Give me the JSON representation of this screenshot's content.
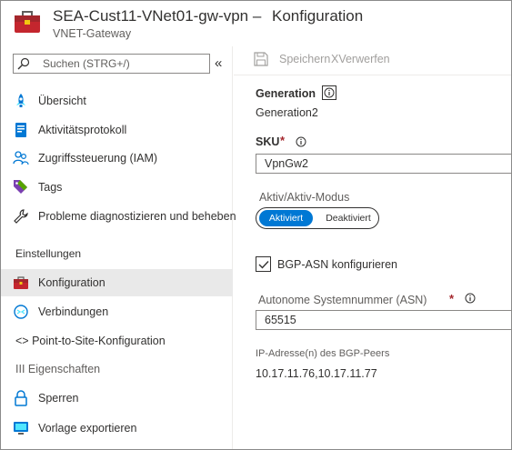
{
  "header": {
    "title": "SEA-Cust11-VNet01-gw-vpn –",
    "blade_title": "Konfiguration",
    "subtitle": "VNET-Gateway"
  },
  "sidebar": {
    "search_placeholder": "Suchen (STRG+/)",
    "collapse": "«",
    "items": [
      {
        "label": "Übersicht",
        "icon": "rocket-icon"
      },
      {
        "label": "Aktivitätsprotokoll",
        "icon": "log-icon"
      },
      {
        "label": "Zugriffssteuerung (IAM)",
        "icon": "people-icon"
      },
      {
        "label": "Tags",
        "icon": "tag-icon"
      },
      {
        "label": "Probleme diagnostizieren und beheben",
        "icon": "wrench-icon"
      }
    ],
    "section_header": "Einstellungen",
    "settings_items": [
      {
        "label": "Konfiguration",
        "icon": "toolbox-icon",
        "active": true
      },
      {
        "label": "Verbindungen",
        "icon": "connections-icon"
      },
      {
        "label": "<> Point-to-Site-Konfiguration"
      },
      {
        "label": "III Eigenschaften"
      },
      {
        "label": "Sperren",
        "icon": "lock-icon"
      },
      {
        "label": "Vorlage exportieren",
        "icon": "export-icon"
      }
    ]
  },
  "toolbar": {
    "save_label": "Speichern",
    "discard_label": "XVerwerfen"
  },
  "config": {
    "generation_label": "Generation",
    "generation_value": "Generation2",
    "sku_label": "SKU",
    "sku_required": "*",
    "sku_value": "VpnGw2",
    "active_mode_label": "Aktiv/Aktiv-Modus",
    "active_mode_on": "Aktiviert",
    "active_mode_off": "Deaktiviert",
    "active_mode_selected": "Aktiviert",
    "bgp_checkbox_label": "BGP-ASN konfigurieren",
    "bgp_checked": true,
    "asn_label": "Autonome Systemnummer (ASN)",
    "asn_required": "*",
    "asn_value": "65515",
    "bgp_peers_label": "IP-Adresse(n) des BGP-Peers",
    "bgp_peers_value": "10.17.11.76,10.17.11.77"
  },
  "colors": {
    "accent": "#0078d4",
    "required": "#a4262c",
    "active_nav_bg": "#e9e9e9"
  }
}
